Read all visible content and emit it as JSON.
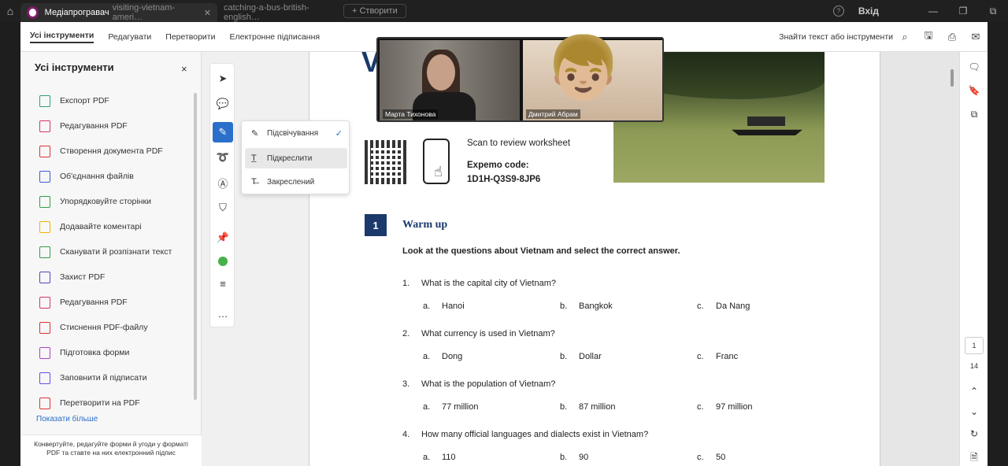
{
  "titlebar": {
    "active_tab": "Медіапрогравач",
    "active_tab_faded": "visiting-vietnam-ameri…",
    "second_tab": "catching-a-bus-british-english…",
    "new_tab": "+ Створити",
    "signin": "Вхід",
    "help": "?",
    "minimize": "—",
    "restore": "❐",
    "maximize": "⧉"
  },
  "toolbar": {
    "nav": [
      "Усі інструменти",
      "Редагувати",
      "Перетворити",
      "Електронне підписання"
    ],
    "search_label": "Знайти текст або інструменти"
  },
  "leftpanel": {
    "title": "Усі інструменти",
    "close": "×",
    "items": [
      {
        "label": "Експорт PDF",
        "color": "#2aa56b"
      },
      {
        "label": "Редагування PDF",
        "color": "#d6336c"
      },
      {
        "label": "Створення документа PDF",
        "color": "#e03131"
      },
      {
        "label": "Об'єднання файлів",
        "color": "#3b5bdb"
      },
      {
        "label": "Упорядковуйте сторінки",
        "color": "#2f9e44"
      },
      {
        "label": "Додавайте коментарі",
        "color": "#f0b400"
      },
      {
        "label": "Сканувати й розпізнати текст",
        "color": "#2f9e44"
      },
      {
        "label": "Захист PDF",
        "color": "#5f3dc4"
      },
      {
        "label": "Редагування PDF",
        "color": "#d6336c"
      },
      {
        "label": "Стиснення PDF-файлу",
        "color": "#e03131"
      },
      {
        "label": "Підготовка форми",
        "color": "#ae3ec9"
      },
      {
        "label": "Заповнити й підписати",
        "color": "#7048e8"
      },
      {
        "label": "Перетворити на PDF",
        "color": "#e03131"
      }
    ],
    "show_more": "Показати більше",
    "footer": "Конвертуйте, редагуйте форми й угоди у форматі PDF та ставте на них електронний підпис"
  },
  "menu": {
    "items": [
      "Підсвічування",
      "Підкреслити",
      "Закреслений"
    ]
  },
  "video": {
    "person1": "Марта Тихонова",
    "person2": "Дмитрий Абрам"
  },
  "page": {
    "big_letter": "V",
    "scan": "Scan to review worksheet",
    "code_label": "Expemo code:",
    "code": "1D1H-Q3S9-8JP6",
    "section_number": "1",
    "section_title": "Warm up",
    "instruction": "Look at the questions about Vietnam and select the correct answer.",
    "questions": [
      {
        "n": "1.",
        "text": "What is the capital city of Vietnam?",
        "a": "Hanoi",
        "b": "Bangkok",
        "c": "Da Nang"
      },
      {
        "n": "2.",
        "text": "What currency is used in Vietnam?",
        "a": "Dong",
        "b": "Dollar",
        "c": "Franc"
      },
      {
        "n": "3.",
        "text": "What is the population of Vietnam?",
        "a": "77 million",
        "b": "87 million",
        "c": "97 million"
      },
      {
        "n": "4.",
        "text": "How many official languages and dialects exist in Vietnam?",
        "a": "110",
        "b": "90",
        "c": "50"
      }
    ],
    "option_letters": [
      "a.",
      "b.",
      "c."
    ]
  },
  "rail": {
    "current_page": "1",
    "total_pages": "14"
  },
  "colors": {
    "accent": "#2a6fc9",
    "heading_blue": "#1b3a6b",
    "green_dot": "#46b04a"
  }
}
